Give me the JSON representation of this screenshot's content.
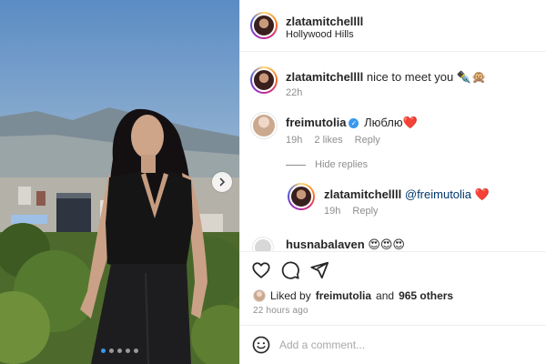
{
  "post": {
    "username": "zlatamitchellll",
    "location": "Hollywood Hills",
    "carousel": {
      "total": 5,
      "active_index": 0
    }
  },
  "comments": [
    {
      "username": "zlatamitchellll",
      "text": "nice to meet you",
      "emoji": "✒️🙊",
      "time": "22h"
    },
    {
      "username": "freimutolia",
      "verified_icon": "verified-badge-icon",
      "text": "Люблю",
      "emoji": "❤️",
      "time": "19h",
      "likes": "2 likes",
      "reply_label": "Reply",
      "hide_replies_label": "Hide replies",
      "replies": [
        {
          "username": "zlatamitchellll",
          "text": "@freimutolia",
          "emoji": "❤️",
          "time": "19h",
          "reply_label": "Reply"
        }
      ]
    },
    {
      "username": "husnabalaven",
      "emoji": "😍😍😍"
    }
  ],
  "actions": {
    "icons": [
      "heart-icon",
      "comment-icon",
      "share-icon",
      "bookmark-icon"
    ]
  },
  "liked_by": {
    "prefix": "Liked by",
    "user": "freimutolia",
    "and": "and",
    "others": "965 others"
  },
  "posted_time": "22 hours ago",
  "composer": {
    "placeholder": "Add a comment..."
  },
  "colors": {
    "link_blue": "#3897f0",
    "meta_gray": "#8e8e8e",
    "text_dark": "#262626",
    "heart_red": "#ed1c24"
  }
}
